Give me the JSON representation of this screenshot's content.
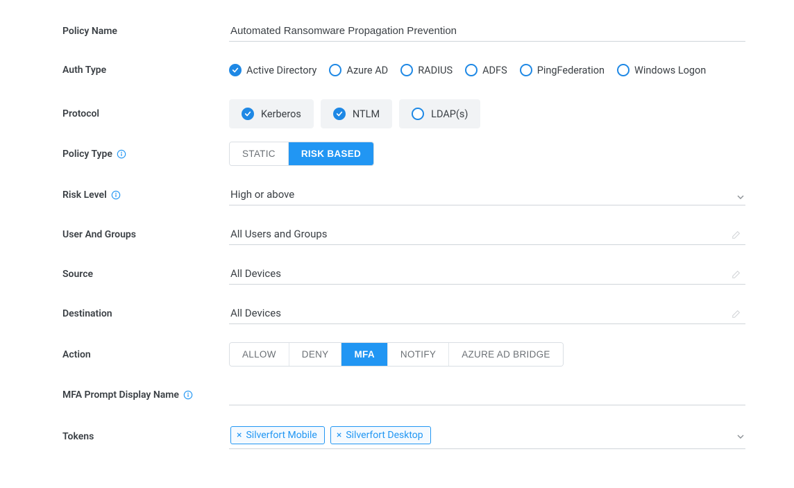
{
  "colors": {
    "accent": "#2196f3",
    "text": "#3a3f44",
    "border": "#cfd4d9"
  },
  "policy_name": {
    "label": "Policy Name",
    "value": "Automated Ransomware Propagation Prevention"
  },
  "auth_type": {
    "label": "Auth Type",
    "options": [
      {
        "label": "Active Directory",
        "checked": true
      },
      {
        "label": "Azure AD",
        "checked": false
      },
      {
        "label": "RADIUS",
        "checked": false
      },
      {
        "label": "ADFS",
        "checked": false
      },
      {
        "label": "PingFederation",
        "checked": false
      },
      {
        "label": "Windows Logon",
        "checked": false
      }
    ]
  },
  "protocol": {
    "label": "Protocol",
    "options": [
      {
        "label": "Kerberos",
        "checked": true
      },
      {
        "label": "NTLM",
        "checked": true
      },
      {
        "label": "LDAP(s)",
        "checked": false
      }
    ]
  },
  "policy_type": {
    "label": "Policy Type",
    "options": [
      {
        "label": "STATIC",
        "active": false
      },
      {
        "label": "RISK BASED",
        "active": true
      }
    ]
  },
  "risk_level": {
    "label": "Risk Level",
    "value": "High or above"
  },
  "user_groups": {
    "label": "User And Groups",
    "value": "All Users and Groups"
  },
  "source": {
    "label": "Source",
    "value": "All Devices"
  },
  "destination": {
    "label": "Destination",
    "value": "All Devices"
  },
  "action": {
    "label": "Action",
    "options": [
      {
        "label": "ALLOW",
        "active": false
      },
      {
        "label": "DENY",
        "active": false
      },
      {
        "label": "MFA",
        "active": true
      },
      {
        "label": "NOTIFY",
        "active": false
      },
      {
        "label": "AZURE AD BRIDGE",
        "active": false
      }
    ]
  },
  "mfa_prompt": {
    "label": "MFA Prompt Display Name",
    "value": ""
  },
  "tokens": {
    "label": "Tokens",
    "chips": [
      {
        "label": "Silverfort Mobile"
      },
      {
        "label": "Silverfort Desktop"
      }
    ]
  }
}
